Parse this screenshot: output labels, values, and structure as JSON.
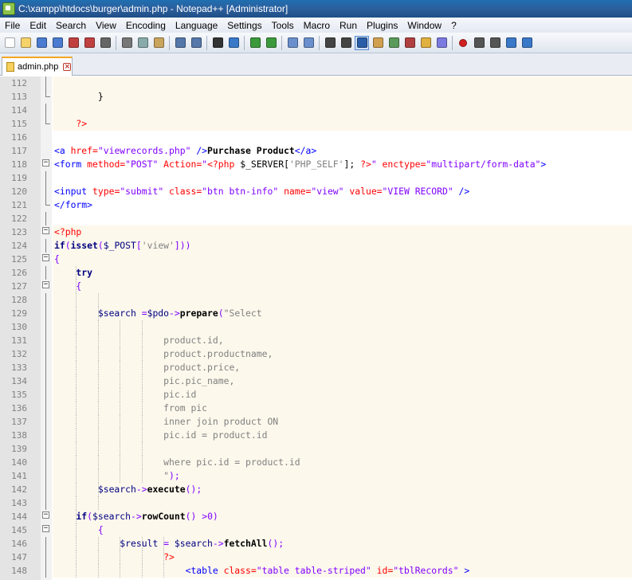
{
  "window": {
    "title": "C:\\xampp\\htdocs\\burger\\admin.php - Notepad++ [Administrator]"
  },
  "menu": [
    "File",
    "Edit",
    "Search",
    "View",
    "Encoding",
    "Language",
    "Settings",
    "Tools",
    "Macro",
    "Run",
    "Plugins",
    "Window",
    "?"
  ],
  "toolbar": {
    "icons": [
      "new-file-icon",
      "open-file-icon",
      "save-icon",
      "save-all-icon",
      "close-icon",
      "close-all-icon",
      "print-icon",
      "cut-icon",
      "copy-icon",
      "paste-icon",
      "undo-icon",
      "redo-icon",
      "find-icon",
      "replace-icon",
      "zoom-in-icon",
      "zoom-out-icon",
      "sync-vertical-icon",
      "sync-horizontal-icon",
      "word-wrap-icon",
      "show-all-chars-icon",
      "indent-guide-icon",
      "user-defined-lang-icon",
      "doc-map-icon",
      "function-list-icon",
      "folder-workspace-icon",
      "monitoring-icon",
      "record-macro-icon",
      "stop-record-icon",
      "play-macro-icon",
      "run-macro-multiple-icon",
      "save-macro-icon"
    ],
    "active_index": 20
  },
  "tab": {
    "label": "admin.php"
  },
  "lines": [
    {
      "n": "112"
    },
    {
      "n": "113",
      "code": [
        [
          "        }",
          "k-plain"
        ]
      ]
    },
    {
      "n": "114"
    },
    {
      "n": "115",
      "code": [
        [
          "    ?>",
          "k-php"
        ]
      ]
    },
    {
      "n": "116"
    },
    {
      "n": "117",
      "code": [
        [
          "<a ",
          "k-tag"
        ],
        [
          "href=",
          "k-attr"
        ],
        [
          "\"viewrecords.php\"",
          "k-str"
        ],
        [
          " />",
          "k-tag"
        ],
        [
          "Purchase Product",
          "k-bold"
        ],
        [
          "</a>",
          "k-tag"
        ]
      ]
    },
    {
      "n": "118",
      "code": [
        [
          "<form ",
          "k-tag"
        ],
        [
          "method=",
          "k-attr"
        ],
        [
          "\"POST\"",
          "k-str"
        ],
        [
          " Action=",
          "k-attr"
        ],
        [
          "\"",
          "k-str"
        ],
        [
          "<?php",
          "k-php"
        ],
        [
          " $_SERVER[",
          "k-plain"
        ],
        [
          "'PHP_SELF'",
          "k-sq"
        ],
        [
          "]; ",
          "k-plain"
        ],
        [
          "?>",
          "k-php"
        ],
        [
          "\"",
          "k-str"
        ],
        [
          " enctype=",
          "k-attr"
        ],
        [
          "\"multipart/form-data\"",
          "k-str"
        ],
        [
          ">",
          "k-tag"
        ]
      ]
    },
    {
      "n": "119"
    },
    {
      "n": "120",
      "code": [
        [
          "<input ",
          "k-tag"
        ],
        [
          "type=",
          "k-attr"
        ],
        [
          "\"submit\"",
          "k-str"
        ],
        [
          " class=",
          "k-attr"
        ],
        [
          "\"btn btn-info\"",
          "k-str"
        ],
        [
          " name=",
          "k-attr"
        ],
        [
          "\"view\"",
          "k-str"
        ],
        [
          " value=",
          "k-attr"
        ],
        [
          "\"VIEW RECORD\"",
          "k-str"
        ],
        [
          " />",
          "k-tag"
        ]
      ]
    },
    {
      "n": "121",
      "code": [
        [
          "</form>",
          "k-tag"
        ]
      ]
    },
    {
      "n": "122"
    },
    {
      "n": "123",
      "code": [
        [
          "<?php",
          "k-php"
        ]
      ]
    },
    {
      "n": "124",
      "code": [
        [
          "if",
          "k-kw"
        ],
        [
          "(",
          "k-op"
        ],
        [
          "isset",
          "k-kw"
        ],
        [
          "(",
          "k-op"
        ],
        [
          "$_POST",
          "k-var"
        ],
        [
          "[",
          "k-op"
        ],
        [
          "'view'",
          "k-sq"
        ],
        [
          "]))",
          "k-op"
        ]
      ]
    },
    {
      "n": "125",
      "code": [
        [
          "{",
          "k-op"
        ]
      ]
    },
    {
      "n": "126",
      "code": [
        [
          "    try",
          "k-kw"
        ]
      ]
    },
    {
      "n": "127",
      "code": [
        [
          "    {",
          "k-op"
        ]
      ]
    },
    {
      "n": "128"
    },
    {
      "n": "129",
      "code": [
        [
          "        $search ",
          "k-var"
        ],
        [
          "=",
          "k-op"
        ],
        [
          "$pdo",
          "k-var"
        ],
        [
          "->",
          "k-op"
        ],
        [
          "prepare",
          "k-fn"
        ],
        [
          "(",
          "k-op"
        ],
        [
          "\"Select",
          "k-dq"
        ]
      ]
    },
    {
      "n": "130"
    },
    {
      "n": "131",
      "code": [
        [
          "                    product.id,",
          "k-dq"
        ]
      ]
    },
    {
      "n": "132",
      "code": [
        [
          "                    product.productname,",
          "k-dq"
        ]
      ]
    },
    {
      "n": "133",
      "code": [
        [
          "                    product.price,",
          "k-dq"
        ]
      ]
    },
    {
      "n": "134",
      "code": [
        [
          "                    pic.pic_name,",
          "k-dq"
        ]
      ]
    },
    {
      "n": "135",
      "code": [
        [
          "                    pic.id",
          "k-dq"
        ]
      ]
    },
    {
      "n": "136",
      "code": [
        [
          "                    from pic",
          "k-dq"
        ]
      ]
    },
    {
      "n": "137",
      "code": [
        [
          "                    inner join product ON",
          "k-dq"
        ]
      ]
    },
    {
      "n": "138",
      "code": [
        [
          "                    pic.id = product.id",
          "k-dq"
        ]
      ]
    },
    {
      "n": "139"
    },
    {
      "n": "140",
      "code": [
        [
          "                    where pic.id = product.id",
          "k-dq"
        ]
      ]
    },
    {
      "n": "141",
      "code": [
        [
          "                    \"",
          "k-dq"
        ],
        [
          ");",
          "k-op"
        ]
      ]
    },
    {
      "n": "142",
      "code": [
        [
          "        $search",
          "k-var"
        ],
        [
          "->",
          "k-op"
        ],
        [
          "execute",
          "k-fn"
        ],
        [
          "();",
          "k-op"
        ]
      ]
    },
    {
      "n": "143"
    },
    {
      "n": "144",
      "code": [
        [
          "    if",
          "k-kw"
        ],
        [
          "(",
          "k-op"
        ],
        [
          "$search",
          "k-var"
        ],
        [
          "->",
          "k-op"
        ],
        [
          "rowCount",
          "k-fn"
        ],
        [
          "() ",
          "k-op"
        ],
        [
          ">",
          "k-op"
        ],
        [
          "0",
          "k-op"
        ],
        [
          ")",
          "k-op"
        ]
      ]
    },
    {
      "n": "145",
      "code": [
        [
          "        {",
          "k-op"
        ]
      ]
    },
    {
      "n": "146",
      "code": [
        [
          "            $result ",
          "k-var"
        ],
        [
          "= ",
          "k-op"
        ],
        [
          "$search",
          "k-var"
        ],
        [
          "->",
          "k-op"
        ],
        [
          "fetchAll",
          "k-fn"
        ],
        [
          "();",
          "k-op"
        ]
      ]
    },
    {
      "n": "147",
      "code": [
        [
          "                    ?>",
          "k-php"
        ]
      ]
    },
    {
      "n": "148",
      "code": [
        [
          "                        <table ",
          "k-tag"
        ],
        [
          "class=",
          "k-attr"
        ],
        [
          "\"table table-striped\"",
          "k-str"
        ],
        [
          " id=",
          "k-attr"
        ],
        [
          "\"tblRecords\"",
          "k-str"
        ],
        [
          " >",
          "k-tag"
        ]
      ]
    }
  ]
}
